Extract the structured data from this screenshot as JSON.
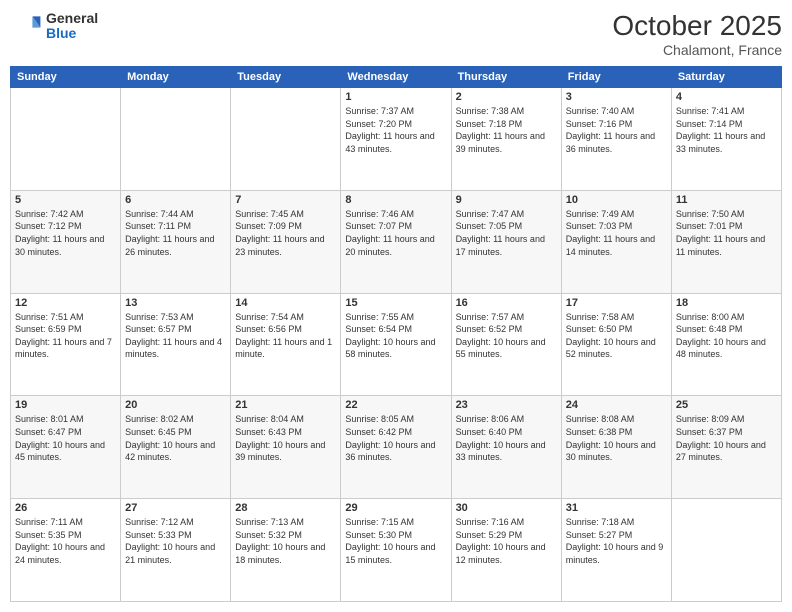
{
  "header": {
    "logo_general": "General",
    "logo_blue": "Blue",
    "month_title": "October 2025",
    "location": "Chalamont, France"
  },
  "days_of_week": [
    "Sunday",
    "Monday",
    "Tuesday",
    "Wednesday",
    "Thursday",
    "Friday",
    "Saturday"
  ],
  "weeks": [
    [
      {
        "day": "",
        "info": ""
      },
      {
        "day": "",
        "info": ""
      },
      {
        "day": "",
        "info": ""
      },
      {
        "day": "1",
        "info": "Sunrise: 7:37 AM\nSunset: 7:20 PM\nDaylight: 11 hours and 43 minutes."
      },
      {
        "day": "2",
        "info": "Sunrise: 7:38 AM\nSunset: 7:18 PM\nDaylight: 11 hours and 39 minutes."
      },
      {
        "day": "3",
        "info": "Sunrise: 7:40 AM\nSunset: 7:16 PM\nDaylight: 11 hours and 36 minutes."
      },
      {
        "day": "4",
        "info": "Sunrise: 7:41 AM\nSunset: 7:14 PM\nDaylight: 11 hours and 33 minutes."
      }
    ],
    [
      {
        "day": "5",
        "info": "Sunrise: 7:42 AM\nSunset: 7:12 PM\nDaylight: 11 hours and 30 minutes."
      },
      {
        "day": "6",
        "info": "Sunrise: 7:44 AM\nSunset: 7:11 PM\nDaylight: 11 hours and 26 minutes."
      },
      {
        "day": "7",
        "info": "Sunrise: 7:45 AM\nSunset: 7:09 PM\nDaylight: 11 hours and 23 minutes."
      },
      {
        "day": "8",
        "info": "Sunrise: 7:46 AM\nSunset: 7:07 PM\nDaylight: 11 hours and 20 minutes."
      },
      {
        "day": "9",
        "info": "Sunrise: 7:47 AM\nSunset: 7:05 PM\nDaylight: 11 hours and 17 minutes."
      },
      {
        "day": "10",
        "info": "Sunrise: 7:49 AM\nSunset: 7:03 PM\nDaylight: 11 hours and 14 minutes."
      },
      {
        "day": "11",
        "info": "Sunrise: 7:50 AM\nSunset: 7:01 PM\nDaylight: 11 hours and 11 minutes."
      }
    ],
    [
      {
        "day": "12",
        "info": "Sunrise: 7:51 AM\nSunset: 6:59 PM\nDaylight: 11 hours and 7 minutes."
      },
      {
        "day": "13",
        "info": "Sunrise: 7:53 AM\nSunset: 6:57 PM\nDaylight: 11 hours and 4 minutes."
      },
      {
        "day": "14",
        "info": "Sunrise: 7:54 AM\nSunset: 6:56 PM\nDaylight: 11 hours and 1 minute."
      },
      {
        "day": "15",
        "info": "Sunrise: 7:55 AM\nSunset: 6:54 PM\nDaylight: 10 hours and 58 minutes."
      },
      {
        "day": "16",
        "info": "Sunrise: 7:57 AM\nSunset: 6:52 PM\nDaylight: 10 hours and 55 minutes."
      },
      {
        "day": "17",
        "info": "Sunrise: 7:58 AM\nSunset: 6:50 PM\nDaylight: 10 hours and 52 minutes."
      },
      {
        "day": "18",
        "info": "Sunrise: 8:00 AM\nSunset: 6:48 PM\nDaylight: 10 hours and 48 minutes."
      }
    ],
    [
      {
        "day": "19",
        "info": "Sunrise: 8:01 AM\nSunset: 6:47 PM\nDaylight: 10 hours and 45 minutes."
      },
      {
        "day": "20",
        "info": "Sunrise: 8:02 AM\nSunset: 6:45 PM\nDaylight: 10 hours and 42 minutes."
      },
      {
        "day": "21",
        "info": "Sunrise: 8:04 AM\nSunset: 6:43 PM\nDaylight: 10 hours and 39 minutes."
      },
      {
        "day": "22",
        "info": "Sunrise: 8:05 AM\nSunset: 6:42 PM\nDaylight: 10 hours and 36 minutes."
      },
      {
        "day": "23",
        "info": "Sunrise: 8:06 AM\nSunset: 6:40 PM\nDaylight: 10 hours and 33 minutes."
      },
      {
        "day": "24",
        "info": "Sunrise: 8:08 AM\nSunset: 6:38 PM\nDaylight: 10 hours and 30 minutes."
      },
      {
        "day": "25",
        "info": "Sunrise: 8:09 AM\nSunset: 6:37 PM\nDaylight: 10 hours and 27 minutes."
      }
    ],
    [
      {
        "day": "26",
        "info": "Sunrise: 7:11 AM\nSunset: 5:35 PM\nDaylight: 10 hours and 24 minutes."
      },
      {
        "day": "27",
        "info": "Sunrise: 7:12 AM\nSunset: 5:33 PM\nDaylight: 10 hours and 21 minutes."
      },
      {
        "day": "28",
        "info": "Sunrise: 7:13 AM\nSunset: 5:32 PM\nDaylight: 10 hours and 18 minutes."
      },
      {
        "day": "29",
        "info": "Sunrise: 7:15 AM\nSunset: 5:30 PM\nDaylight: 10 hours and 15 minutes."
      },
      {
        "day": "30",
        "info": "Sunrise: 7:16 AM\nSunset: 5:29 PM\nDaylight: 10 hours and 12 minutes."
      },
      {
        "day": "31",
        "info": "Sunrise: 7:18 AM\nSunset: 5:27 PM\nDaylight: 10 hours and 9 minutes."
      },
      {
        "day": "",
        "info": ""
      }
    ]
  ]
}
